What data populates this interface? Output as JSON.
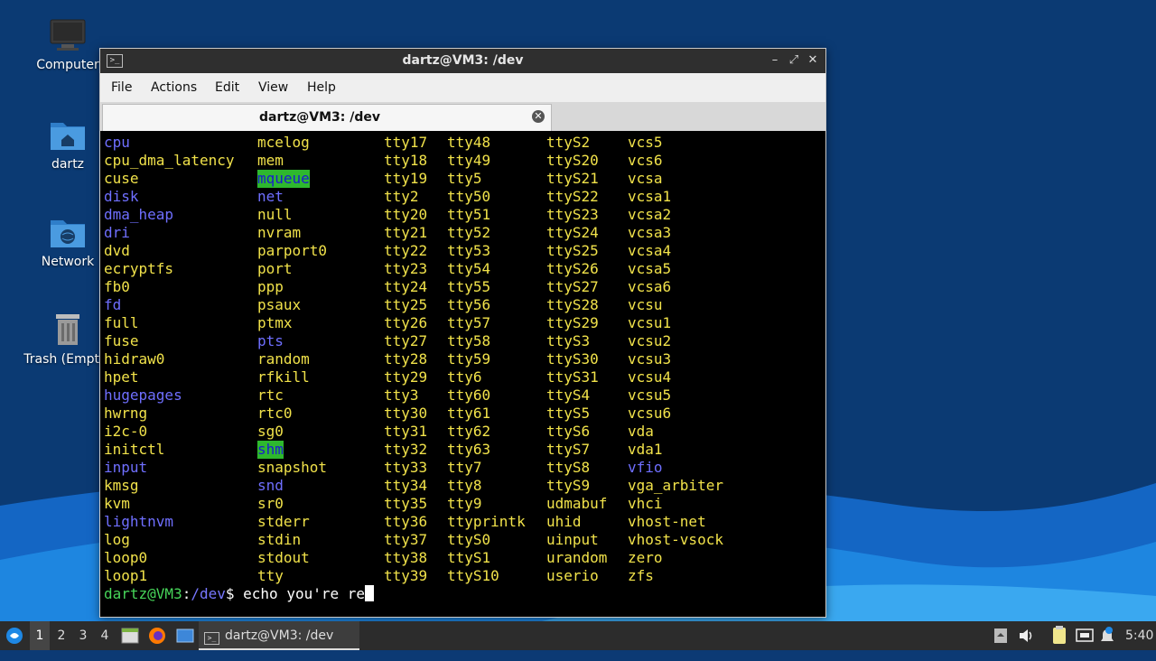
{
  "desktop": {
    "icons": [
      {
        "label": "Computer",
        "icon": "computer-icon"
      },
      {
        "label": "dartz",
        "icon": "home-folder-icon"
      },
      {
        "label": "Network",
        "icon": "network-folder-icon"
      },
      {
        "label": "Trash (Empty)",
        "icon": "trash-icon"
      }
    ]
  },
  "window": {
    "title": "dartz@VM3: /dev",
    "menu": [
      "File",
      "Actions",
      "Edit",
      "View",
      "Help"
    ],
    "tab_label": "dartz@VM3: /dev",
    "buttons": {
      "minimize": "–",
      "maximize": "⤢",
      "close": "✕"
    }
  },
  "terminal": {
    "columns": [
      [
        {
          "t": "cpu",
          "s": "dir"
        },
        {
          "t": "cpu_dma_latency",
          "s": "dev"
        },
        {
          "t": "cuse",
          "s": "dev"
        },
        {
          "t": "disk",
          "s": "dir"
        },
        {
          "t": "dma_heap",
          "s": "dir"
        },
        {
          "t": "dri",
          "s": "dir"
        },
        {
          "t": "dvd",
          "s": "dev"
        },
        {
          "t": "ecryptfs",
          "s": "dev"
        },
        {
          "t": "fb0",
          "s": "dev"
        },
        {
          "t": "fd",
          "s": "dir"
        },
        {
          "t": "full",
          "s": "dev"
        },
        {
          "t": "fuse",
          "s": "dev"
        },
        {
          "t": "hidraw0",
          "s": "dev"
        },
        {
          "t": "hpet",
          "s": "dev"
        },
        {
          "t": "hugepages",
          "s": "dir"
        },
        {
          "t": "hwrng",
          "s": "dev"
        },
        {
          "t": "i2c-0",
          "s": "dev"
        },
        {
          "t": "initctl",
          "s": "dev"
        },
        {
          "t": "input",
          "s": "dir"
        },
        {
          "t": "kmsg",
          "s": "dev"
        },
        {
          "t": "kvm",
          "s": "dev"
        },
        {
          "t": "lightnvm",
          "s": "dir"
        },
        {
          "t": "log",
          "s": "dev"
        },
        {
          "t": "loop0",
          "s": "dev"
        },
        {
          "t": "loop1",
          "s": "dev"
        }
      ],
      [
        {
          "t": "mcelog",
          "s": "dev"
        },
        {
          "t": "mem",
          "s": "dev"
        },
        {
          "t": "mqueue",
          "s": "hl"
        },
        {
          "t": "net",
          "s": "dir"
        },
        {
          "t": "null",
          "s": "dev"
        },
        {
          "t": "nvram",
          "s": "dev"
        },
        {
          "t": "parport0",
          "s": "dev"
        },
        {
          "t": "port",
          "s": "dev"
        },
        {
          "t": "ppp",
          "s": "dev"
        },
        {
          "t": "psaux",
          "s": "dev"
        },
        {
          "t": "ptmx",
          "s": "dev"
        },
        {
          "t": "pts",
          "s": "dir"
        },
        {
          "t": "random",
          "s": "dev"
        },
        {
          "t": "rfkill",
          "s": "dev"
        },
        {
          "t": "rtc",
          "s": "dev"
        },
        {
          "t": "rtc0",
          "s": "dev"
        },
        {
          "t": "sg0",
          "s": "dev"
        },
        {
          "t": "shm",
          "s": "hl"
        },
        {
          "t": "snapshot",
          "s": "dev"
        },
        {
          "t": "snd",
          "s": "dir"
        },
        {
          "t": "sr0",
          "s": "dev"
        },
        {
          "t": "stderr",
          "s": "dev"
        },
        {
          "t": "stdin",
          "s": "dev"
        },
        {
          "t": "stdout",
          "s": "dev"
        },
        {
          "t": "tty",
          "s": "dev"
        }
      ],
      [
        {
          "t": "tty17",
          "s": "dev"
        },
        {
          "t": "tty18",
          "s": "dev"
        },
        {
          "t": "tty19",
          "s": "dev"
        },
        {
          "t": "tty2",
          "s": "dev"
        },
        {
          "t": "tty20",
          "s": "dev"
        },
        {
          "t": "tty21",
          "s": "dev"
        },
        {
          "t": "tty22",
          "s": "dev"
        },
        {
          "t": "tty23",
          "s": "dev"
        },
        {
          "t": "tty24",
          "s": "dev"
        },
        {
          "t": "tty25",
          "s": "dev"
        },
        {
          "t": "tty26",
          "s": "dev"
        },
        {
          "t": "tty27",
          "s": "dev"
        },
        {
          "t": "tty28",
          "s": "dev"
        },
        {
          "t": "tty29",
          "s": "dev"
        },
        {
          "t": "tty3",
          "s": "dev"
        },
        {
          "t": "tty30",
          "s": "dev"
        },
        {
          "t": "tty31",
          "s": "dev"
        },
        {
          "t": "tty32",
          "s": "dev"
        },
        {
          "t": "tty33",
          "s": "dev"
        },
        {
          "t": "tty34",
          "s": "dev"
        },
        {
          "t": "tty35",
          "s": "dev"
        },
        {
          "t": "tty36",
          "s": "dev"
        },
        {
          "t": "tty37",
          "s": "dev"
        },
        {
          "t": "tty38",
          "s": "dev"
        },
        {
          "t": "tty39",
          "s": "dev"
        }
      ],
      [
        {
          "t": "tty48",
          "s": "dev"
        },
        {
          "t": "tty49",
          "s": "dev"
        },
        {
          "t": "tty5",
          "s": "dev"
        },
        {
          "t": "tty50",
          "s": "dev"
        },
        {
          "t": "tty51",
          "s": "dev"
        },
        {
          "t": "tty52",
          "s": "dev"
        },
        {
          "t": "tty53",
          "s": "dev"
        },
        {
          "t": "tty54",
          "s": "dev"
        },
        {
          "t": "tty55",
          "s": "dev"
        },
        {
          "t": "tty56",
          "s": "dev"
        },
        {
          "t": "tty57",
          "s": "dev"
        },
        {
          "t": "tty58",
          "s": "dev"
        },
        {
          "t": "tty59",
          "s": "dev"
        },
        {
          "t": "tty6",
          "s": "dev"
        },
        {
          "t": "tty60",
          "s": "dev"
        },
        {
          "t": "tty61",
          "s": "dev"
        },
        {
          "t": "tty62",
          "s": "dev"
        },
        {
          "t": "tty63",
          "s": "dev"
        },
        {
          "t": "tty7",
          "s": "dev"
        },
        {
          "t": "tty8",
          "s": "dev"
        },
        {
          "t": "tty9",
          "s": "dev"
        },
        {
          "t": "ttyprintk",
          "s": "dev"
        },
        {
          "t": "ttyS0",
          "s": "dev"
        },
        {
          "t": "ttyS1",
          "s": "dev"
        },
        {
          "t": "ttyS10",
          "s": "dev"
        }
      ],
      [
        {
          "t": "ttyS2",
          "s": "dev"
        },
        {
          "t": "ttyS20",
          "s": "dev"
        },
        {
          "t": "ttyS21",
          "s": "dev"
        },
        {
          "t": "ttyS22",
          "s": "dev"
        },
        {
          "t": "ttyS23",
          "s": "dev"
        },
        {
          "t": "ttyS24",
          "s": "dev"
        },
        {
          "t": "ttyS25",
          "s": "dev"
        },
        {
          "t": "ttyS26",
          "s": "dev"
        },
        {
          "t": "ttyS27",
          "s": "dev"
        },
        {
          "t": "ttyS28",
          "s": "dev"
        },
        {
          "t": "ttyS29",
          "s": "dev"
        },
        {
          "t": "ttyS3",
          "s": "dev"
        },
        {
          "t": "ttyS30",
          "s": "dev"
        },
        {
          "t": "ttyS31",
          "s": "dev"
        },
        {
          "t": "ttyS4",
          "s": "dev"
        },
        {
          "t": "ttyS5",
          "s": "dev"
        },
        {
          "t": "ttyS6",
          "s": "dev"
        },
        {
          "t": "ttyS7",
          "s": "dev"
        },
        {
          "t": "ttyS8",
          "s": "dev"
        },
        {
          "t": "ttyS9",
          "s": "dev"
        },
        {
          "t": "udmabuf",
          "s": "dev"
        },
        {
          "t": "uhid",
          "s": "dev"
        },
        {
          "t": "uinput",
          "s": "dev"
        },
        {
          "t": "urandom",
          "s": "dev"
        },
        {
          "t": "userio",
          "s": "dev"
        }
      ],
      [
        {
          "t": "vcs5",
          "s": "dev"
        },
        {
          "t": "vcs6",
          "s": "dev"
        },
        {
          "t": "vcsa",
          "s": "dev"
        },
        {
          "t": "vcsa1",
          "s": "dev"
        },
        {
          "t": "vcsa2",
          "s": "dev"
        },
        {
          "t": "vcsa3",
          "s": "dev"
        },
        {
          "t": "vcsa4",
          "s": "dev"
        },
        {
          "t": "vcsa5",
          "s": "dev"
        },
        {
          "t": "vcsa6",
          "s": "dev"
        },
        {
          "t": "vcsu",
          "s": "dev"
        },
        {
          "t": "vcsu1",
          "s": "dev"
        },
        {
          "t": "vcsu2",
          "s": "dev"
        },
        {
          "t": "vcsu3",
          "s": "dev"
        },
        {
          "t": "vcsu4",
          "s": "dev"
        },
        {
          "t": "vcsu5",
          "s": "dev"
        },
        {
          "t": "vcsu6",
          "s": "dev"
        },
        {
          "t": "vda",
          "s": "dev"
        },
        {
          "t": "vda1",
          "s": "dev"
        },
        {
          "t": "vfio",
          "s": "dir"
        },
        {
          "t": "vga_arbiter",
          "s": "dev"
        },
        {
          "t": "vhci",
          "s": "dev"
        },
        {
          "t": "vhost-net",
          "s": "dev"
        },
        {
          "t": "vhost-vsock",
          "s": "dev"
        },
        {
          "t": "zero",
          "s": "dev"
        },
        {
          "t": "zfs",
          "s": "dev"
        }
      ]
    ],
    "prompt": {
      "user_host": "dartz@VM3",
      "colon": ":",
      "path": "/dev",
      "symbol": "$",
      "command": " echo you're re"
    }
  },
  "taskbar": {
    "workspaces": [
      "1",
      "2",
      "3",
      "4"
    ],
    "active_workspace": "1",
    "task_label": "dartz@VM3: /dev",
    "clock": "5:40"
  },
  "colors": {
    "dir": "#6f6fff",
    "device": "#f1e24a",
    "highlight_bg": "#2eb82e",
    "prompt_user": "#47d65a",
    "terminal_bg": "#000000",
    "desktop_bg": "#0c3a74"
  }
}
